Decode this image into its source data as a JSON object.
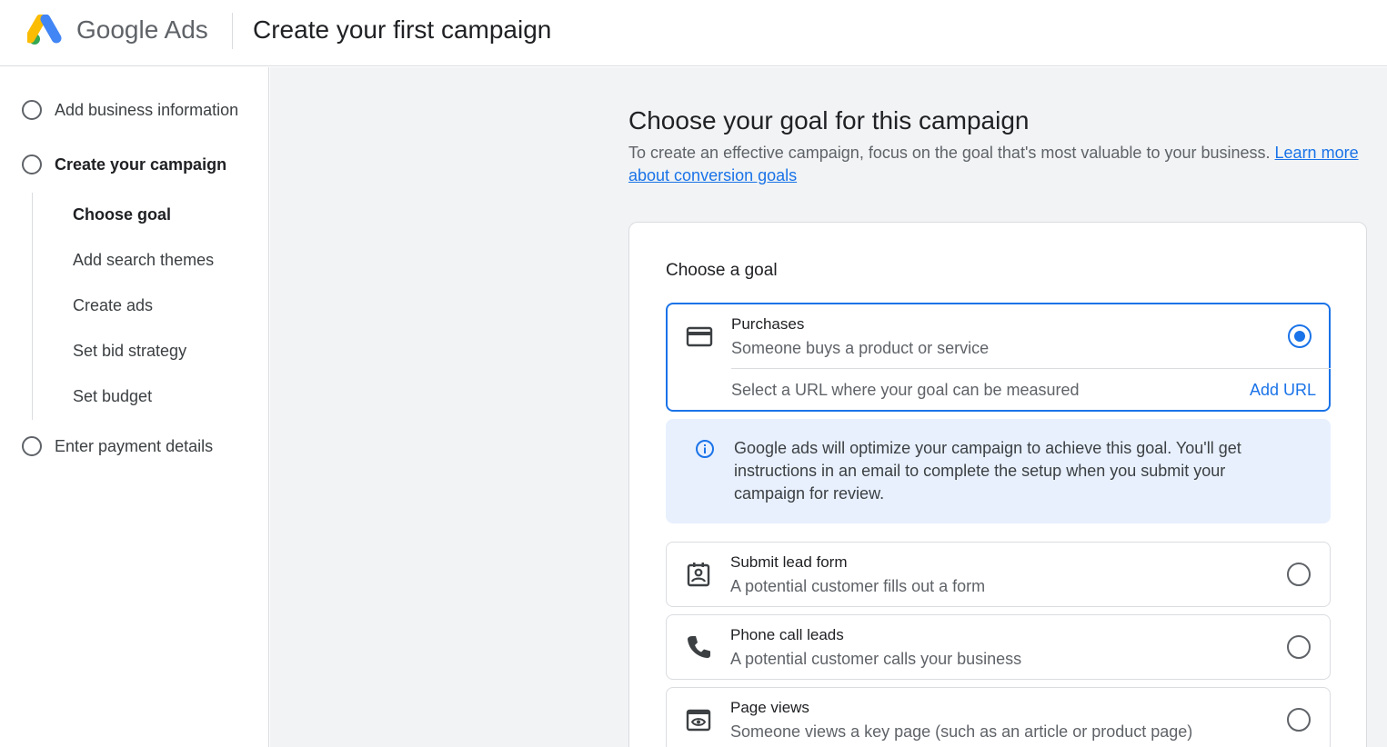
{
  "header": {
    "brand_google": "Google",
    "brand_ads": "Ads",
    "title": "Create your first campaign"
  },
  "sidebar": {
    "steps": [
      {
        "label": "Add business information"
      },
      {
        "label": "Create your campaign"
      },
      {
        "label": "Enter payment details"
      }
    ],
    "substeps": [
      {
        "label": "Choose goal"
      },
      {
        "label": "Add search themes"
      },
      {
        "label": "Create ads"
      },
      {
        "label": "Set bid strategy"
      },
      {
        "label": "Set budget"
      }
    ]
  },
  "main": {
    "heading": "Choose your goal for this campaign",
    "description": "To create an effective campaign, focus on the goal that's most valuable to your business. ",
    "learn_more": "Learn more about conversion goals",
    "card_title": "Choose a goal",
    "options": [
      {
        "title": "Purchases",
        "subtitle": "Someone buys a product or service",
        "icon": "credit-card-icon",
        "selected": true
      },
      {
        "title": "Submit lead form",
        "subtitle": "A potential customer fills out a form",
        "icon": "contact-form-icon",
        "selected": false
      },
      {
        "title": "Phone call leads",
        "subtitle": "A potential customer calls your business",
        "icon": "phone-icon",
        "selected": false
      },
      {
        "title": "Page views",
        "subtitle": "Someone views a key page (such as an article or product page)",
        "icon": "page-view-icon",
        "selected": false
      }
    ],
    "url_prompt": "Select a URL where your goal can be measured",
    "add_url": "Add URL",
    "info": "Google ads will optimize your campaign to achieve this goal. You'll get instructions in an email to complete the setup when you submit your campaign for review."
  },
  "colors": {
    "accent": "#1a73e8",
    "info_bg": "#e8f0fe",
    "main_bg": "#f1f3f4"
  }
}
